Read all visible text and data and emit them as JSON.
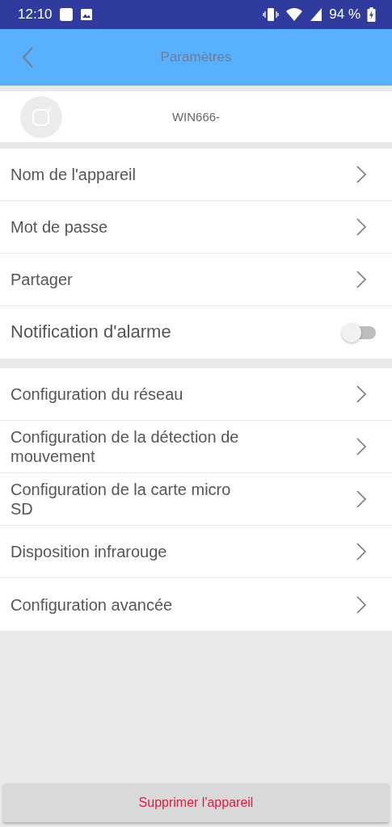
{
  "status_bar": {
    "time": "12:10",
    "battery": "94 %"
  },
  "header": {
    "title": "Paramètres"
  },
  "device": {
    "name": "WIN666-"
  },
  "groups": [
    {
      "items": [
        {
          "kind": "link",
          "label": "Nom de l'appareil"
        },
        {
          "kind": "link",
          "label": "Mot de passe"
        },
        {
          "kind": "link",
          "label": "Partager"
        },
        {
          "kind": "switch",
          "label": "Notification d'alarme",
          "on": false
        }
      ]
    },
    {
      "items": [
        {
          "kind": "link",
          "label": "Configuration du réseau"
        },
        {
          "kind": "link",
          "label": "Configuration de la détection de mouvement"
        },
        {
          "kind": "link",
          "label": "Configuration de la carte micro SD"
        },
        {
          "kind": "link",
          "label": "Disposition infrarouge"
        },
        {
          "kind": "link",
          "label": "Configuration avancée"
        }
      ]
    }
  ],
  "delete_button": "Supprimer l'appareil"
}
